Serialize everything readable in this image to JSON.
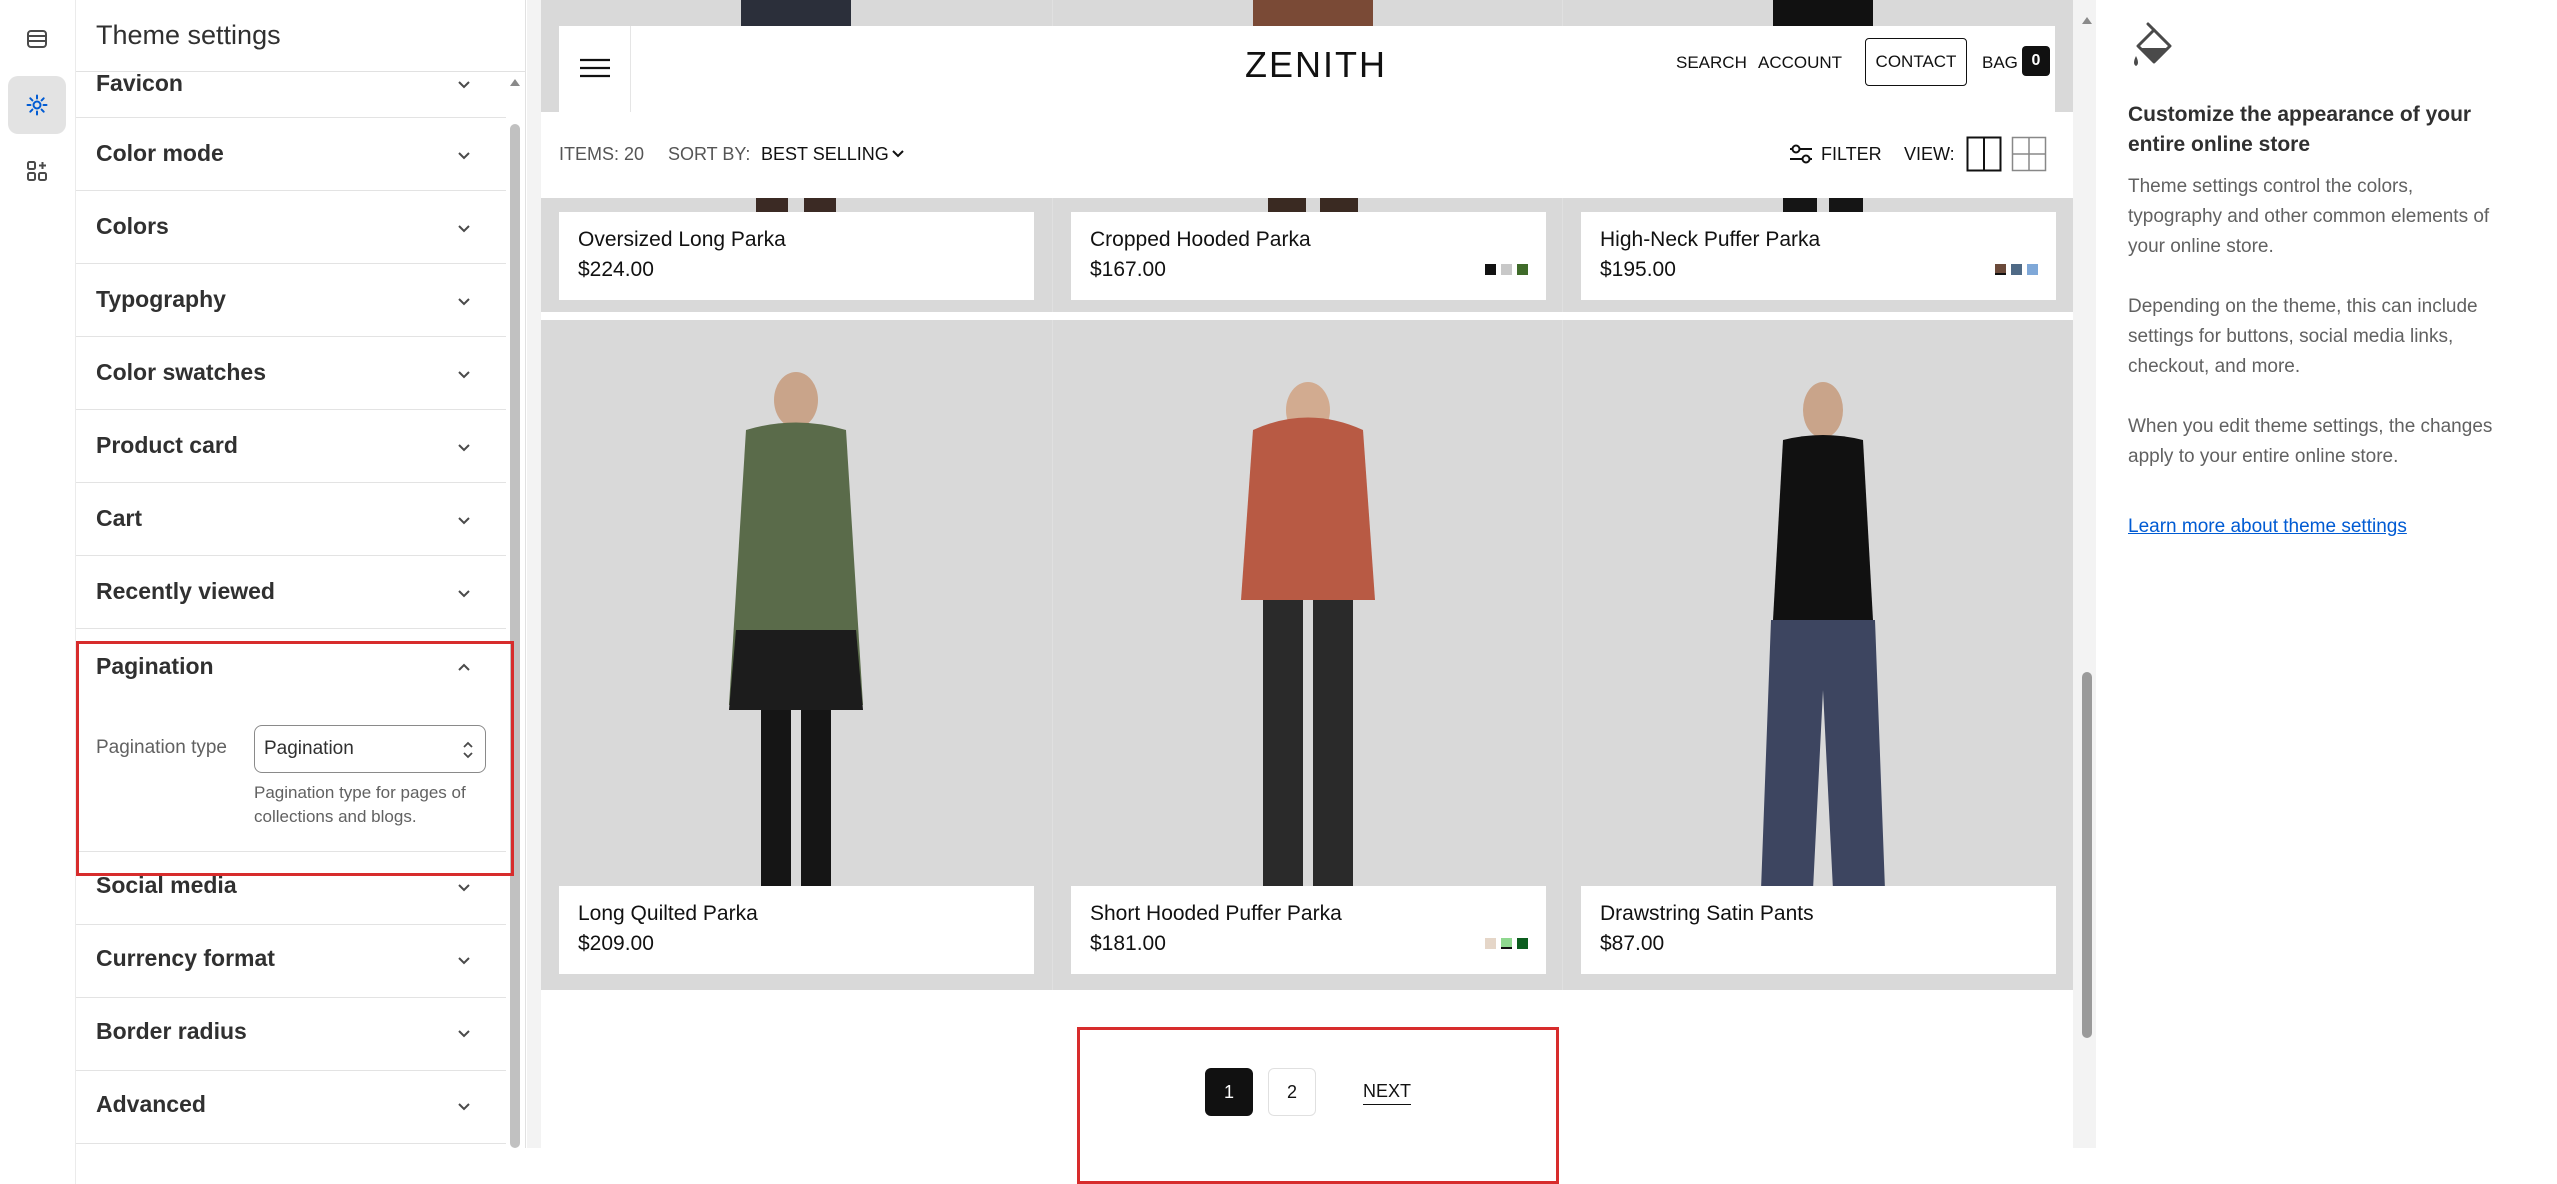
{
  "sidebar": {
    "title": "Theme settings",
    "sections": [
      {
        "label": "Favicon"
      },
      {
        "label": "Color mode"
      },
      {
        "label": "Colors"
      },
      {
        "label": "Typography"
      },
      {
        "label": "Color swatches"
      },
      {
        "label": "Product card"
      },
      {
        "label": "Cart"
      },
      {
        "label": "Recently viewed"
      },
      {
        "label": "Pagination"
      },
      {
        "label": "Social media"
      },
      {
        "label": "Currency format"
      },
      {
        "label": "Border radius"
      },
      {
        "label": "Advanced"
      }
    ],
    "pagination": {
      "field_label": "Pagination type",
      "select_value": "Pagination",
      "help_line1": "Pagination type for pages of",
      "help_line2": "collections and blogs."
    }
  },
  "store": {
    "logo": "ZENITH",
    "nav": {
      "search": "SEARCH",
      "account": "ACCOUNT",
      "contact": "CONTACT",
      "bag": "BAG",
      "bag_count": "0"
    },
    "toolbar": {
      "items": "ITEMS: 20",
      "sort_label": "SORT BY:",
      "sort_value": "BEST SELLING",
      "filter": "FILTER",
      "view": "VIEW:"
    },
    "products_top": [
      {
        "name": "Oversized Long Parka",
        "price": "$224.00",
        "swatches": []
      },
      {
        "name": "Cropped Hooded Parka",
        "price": "$167.00",
        "swatches": [
          "#111111",
          "#c8c8c8",
          "#3f6b2a"
        ]
      },
      {
        "name": "High-Neck Puffer Parka",
        "price": "$195.00",
        "swatches": [
          "#6b4a3a",
          "#4f6a86",
          "#7fa8d8"
        ]
      }
    ],
    "products_bottom": [
      {
        "name": "Long Quilted Parka",
        "price": "$209.00",
        "swatches": []
      },
      {
        "name": "Short Hooded Puffer Parka",
        "price": "$181.00",
        "swatches": [
          "#e5d6c8",
          "#8fd88f",
          "#0b5d1e"
        ]
      },
      {
        "name": "Drawstring Satin Pants",
        "price": "$87.00",
        "swatches": []
      }
    ],
    "pagination": {
      "page1": "1",
      "page2": "2",
      "next": "NEXT"
    }
  },
  "info_panel": {
    "title": "Customize the appearance of your entire online store",
    "para1": "Theme settings control the colors, typography and other common elements of your online store.",
    "para2": "Depending on the theme, this can include settings for buttons, social media links, checkout, and more.",
    "para3": "When you edit theme settings, the changes apply to your entire online store.",
    "link": "Learn more about theme settings"
  },
  "colors": {
    "highlight": "#d72c2c",
    "link": "#005bd3"
  }
}
